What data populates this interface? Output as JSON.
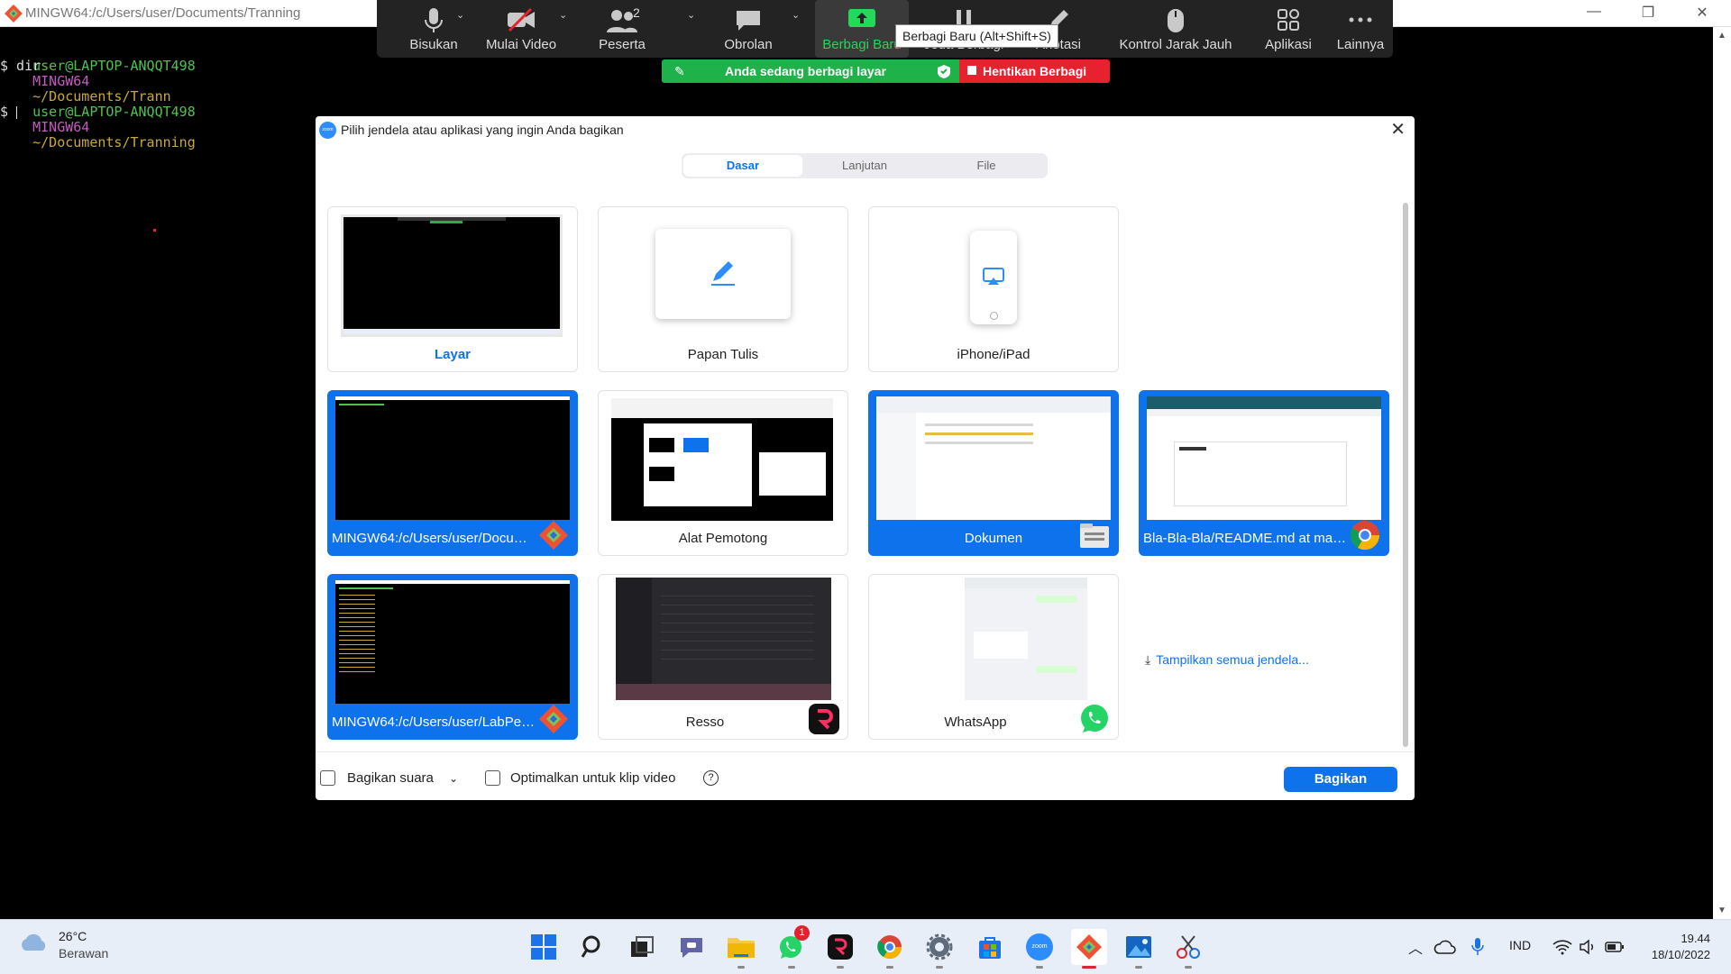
{
  "terminal": {
    "title": "MINGW64:/c/Users/user/Documents/Tranning",
    "prompt_user": "user@LAPTOP-ANQQT498",
    "prompt_env": "MINGW64",
    "path1": "~/Documents/Trann",
    "cmd1": "$ dir",
    "path2": "~/Documents/Tranning",
    "cmd2": "$ "
  },
  "toolbar": {
    "items": [
      {
        "label": "Bisukan",
        "icon": "mic-icon"
      },
      {
        "label": "Mulai Video",
        "icon": "video-off-icon"
      },
      {
        "label": "Peserta",
        "icon": "participants-icon",
        "count": "2"
      },
      {
        "label": "Obrolan",
        "icon": "chat-icon"
      },
      {
        "label": "Berbagi Baru",
        "icon": "share-screen-icon"
      },
      {
        "label": "Jeda Berbagi",
        "icon": "pause-icon"
      },
      {
        "label": "Anotasi",
        "icon": "annotate-icon"
      },
      {
        "label": "Kontrol Jarak Jauh",
        "icon": "mouse-icon"
      },
      {
        "label": "Aplikasi",
        "icon": "apps-icon"
      },
      {
        "label": "Lainnya",
        "icon": "more-icon"
      }
    ],
    "tooltip": "Berbagi Baru (Alt+Shift+S)",
    "banner": "Anda sedang berbagi layar",
    "stop": "Hentikan Berbagi",
    "colors": {
      "accent_green": "#1fb24a",
      "stop_red": "#e8212f"
    }
  },
  "dialog": {
    "title": "Pilih jendela atau aplikasi yang ingin Anda bagikan",
    "logo_text": "zoom",
    "tabs": [
      "Dasar",
      "Lanjutan",
      "File"
    ],
    "selected_tab": "Dasar",
    "cards": [
      {
        "label": "Layar"
      },
      {
        "label": "Papan Tulis"
      },
      {
        "label": "iPhone/iPad"
      },
      {
        "label": "MINGW64:/c/Users/user/Docume..."
      },
      {
        "label": "Alat Pemotong"
      },
      {
        "label": "Dokumen"
      },
      {
        "label": "Bla-Bla-Bla/README.md at main..."
      },
      {
        "label": "MINGW64:/c/Users/user/LabPem..."
      },
      {
        "label": "Resso"
      },
      {
        "label": "WhatsApp"
      }
    ],
    "show_all": "Tampilkan semua jendela...",
    "share_sound": "Bagikan suara",
    "optimize": "Optimalkan untuk klip video",
    "share_button": "Bagikan",
    "colors": {
      "accent_blue": "#0e72ed"
    }
  },
  "taskbar": {
    "temperature": "26°C",
    "weather": "Berawan",
    "language": "IND",
    "time": "19.44",
    "date": "18/10/2022",
    "whatsapp_badge": "1"
  }
}
